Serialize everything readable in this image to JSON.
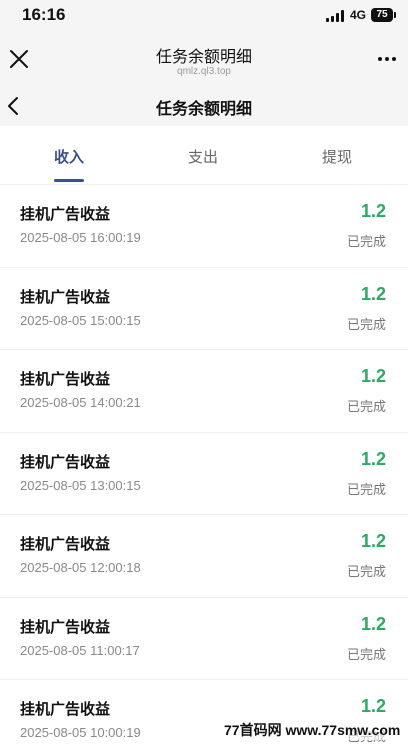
{
  "status_bar": {
    "time": "16:16",
    "network": "4G",
    "battery": "75"
  },
  "browser": {
    "title": "任务余额明细",
    "url": "qmlz.ql3.top",
    "close_icon": "close-icon",
    "more_icon": "more-icon"
  },
  "page": {
    "title": "任务余额明细",
    "back_icon": "back-arrow-icon"
  },
  "tabs": [
    {
      "label": "收入",
      "active": true
    },
    {
      "label": "支出",
      "active": false
    },
    {
      "label": "提现",
      "active": false
    }
  ],
  "colors": {
    "accent": "#3a4f8c",
    "amount": "#2aaa63"
  },
  "records": [
    {
      "title": "挂机广告收益",
      "time": "2025-08-05 16:00:19",
      "amount": "1.2",
      "status": "已完成"
    },
    {
      "title": "挂机广告收益",
      "time": "2025-08-05 15:00:15",
      "amount": "1.2",
      "status": "已完成"
    },
    {
      "title": "挂机广告收益",
      "time": "2025-08-05 14:00:21",
      "amount": "1.2",
      "status": "已完成"
    },
    {
      "title": "挂机广告收益",
      "time": "2025-08-05 13:00:15",
      "amount": "1.2",
      "status": "已完成"
    },
    {
      "title": "挂机广告收益",
      "time": "2025-08-05 12:00:18",
      "amount": "1.2",
      "status": "已完成"
    },
    {
      "title": "挂机广告收益",
      "time": "2025-08-05 11:00:17",
      "amount": "1.2",
      "status": "已完成"
    },
    {
      "title": "挂机广告收益",
      "time": "2025-08-05 10:00:19",
      "amount": "1.2",
      "status": "已完成"
    }
  ],
  "watermark": "77首码网 www.77smw.com"
}
